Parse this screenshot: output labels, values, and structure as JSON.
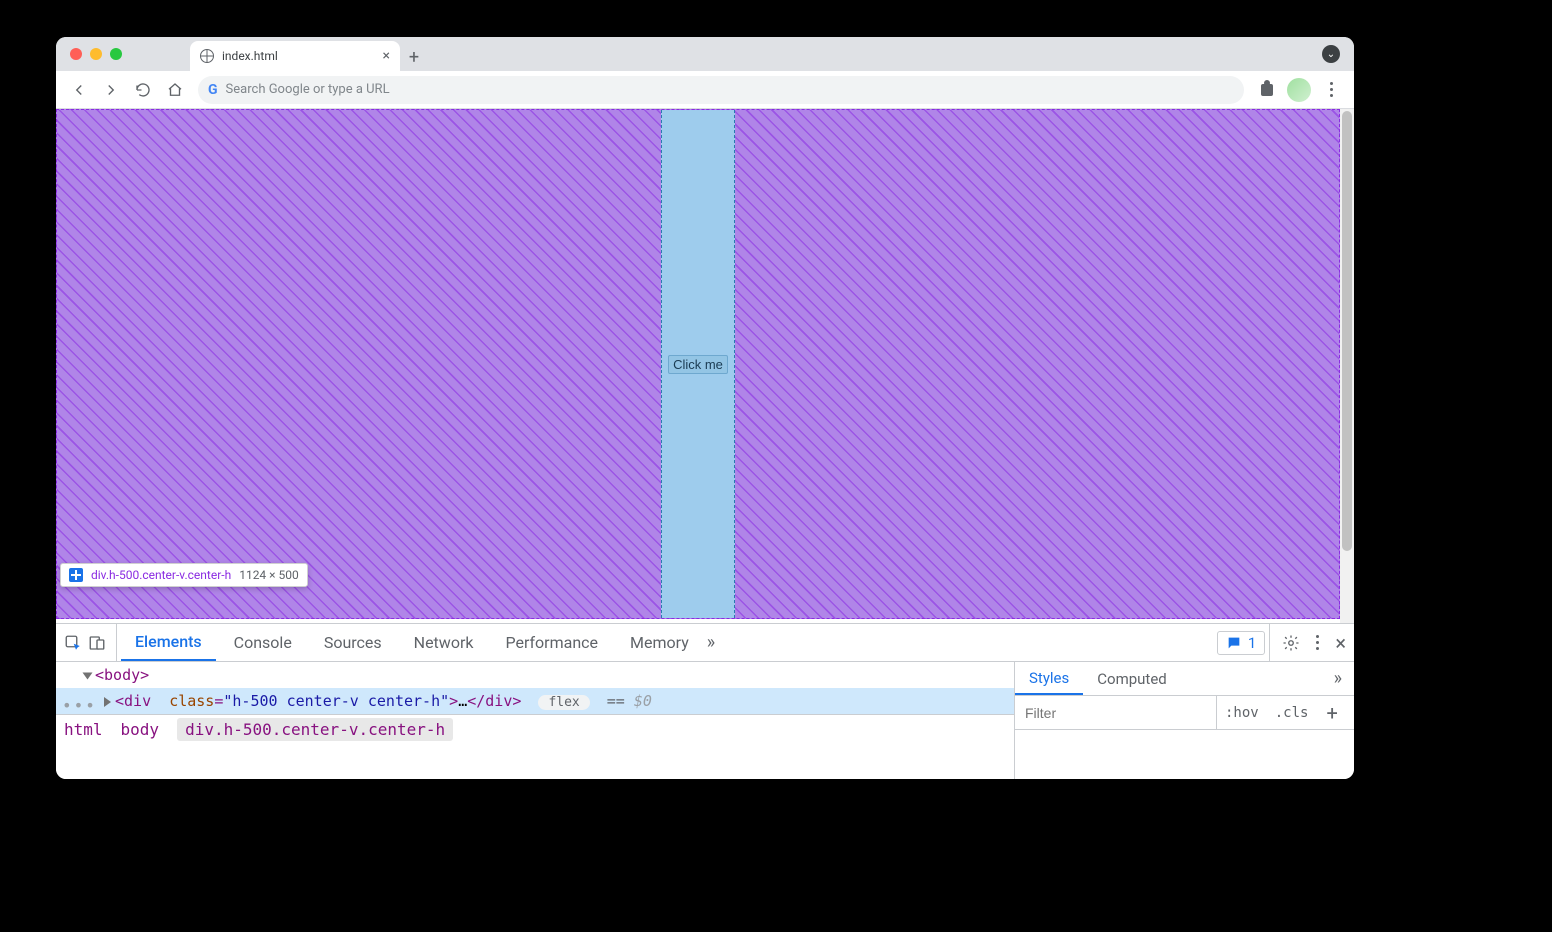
{
  "browser": {
    "tab_title": "index.html",
    "omnibox_placeholder": "Search Google or type a URL"
  },
  "page": {
    "button_label": "Click me",
    "inspect_tooltip": {
      "selector": "div.h-500.center-v.center-h",
      "dimensions": "1124 × 500"
    }
  },
  "devtools": {
    "tabs": {
      "elements": "Elements",
      "console": "Console",
      "sources": "Sources",
      "network": "Network",
      "performance": "Performance",
      "memory": "Memory"
    },
    "issue_count": "1",
    "dom": {
      "body_open": "<body>",
      "div_tag": "div",
      "div_class_attr": "class",
      "div_class_val": "h-500 center-v center-h",
      "ellipsis": "…",
      "div_close": "</div>",
      "flex_badge": "flex",
      "eq": "==",
      "dollar0": "$0"
    },
    "breadcrumbs": {
      "html": "html",
      "body": "body",
      "div": "div.h-500.center-v.center-h"
    },
    "styles": {
      "tab_styles": "Styles",
      "tab_computed": "Computed",
      "filter_placeholder": "Filter",
      "hov": ":hov",
      "cls": ".cls"
    }
  }
}
